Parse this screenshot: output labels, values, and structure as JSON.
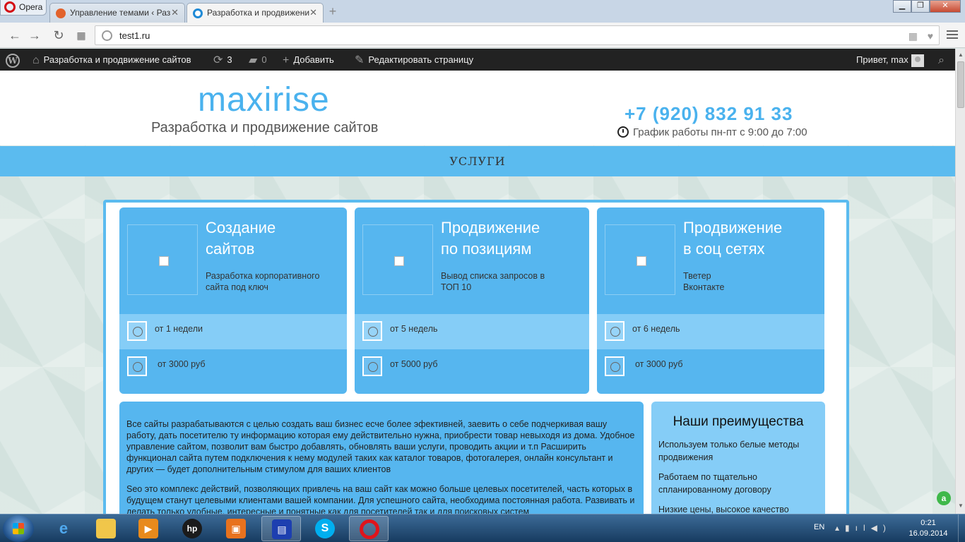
{
  "browser": {
    "menu_label": "Opera",
    "tabs": [
      {
        "title": "Управление темами ‹ Раз",
        "active": false
      },
      {
        "title": "Разработка и продвижени",
        "active": true
      }
    ],
    "url": "test1.ru"
  },
  "admin_bar": {
    "site_name": "Разработка и продвижение сайтов",
    "updates_count": "3",
    "comments_count": "0",
    "add_label": "Добавить",
    "edit_label": "Редактировать страницу",
    "greeting": "Привет, max"
  },
  "header": {
    "logo": "maxirise",
    "tagline": "Разработка и продвижение сайтов",
    "phone": "+7 (920) 832 91 33",
    "hours": "График работы пн-пт с 9:00 до 7:00"
  },
  "nav": {
    "label": "УСЛУГИ"
  },
  "services": [
    {
      "title_line1": "Создание",
      "title_line2": "сайтов",
      "desc_line1": "Разработка корпоративного",
      "desc_line2": "сайта под ключ",
      "term": "от 1 недели",
      "price": "от 3000 руб"
    },
    {
      "title_line1": "Продвижение",
      "title_line2": "по позициям",
      "desc_line1": "Вывод списка запросов в",
      "desc_line2": "ТОП 10",
      "term": "от 5 недель",
      "price": "от 5000 руб"
    },
    {
      "title_line1": "Продвижение",
      "title_line2": "в соц сетях",
      "desc_line1": "Тветер",
      "desc_line2": "Вконтакте",
      "term": "от 6 недель",
      "price": "от 3000 руб"
    }
  ],
  "about": {
    "p1": "Все сайты разрабатываются с целью создать ваш бизнес есче более эфективней, заевить о себе подчеркивая вашу работу, дать посетителю ту информацию которая ему действительно нужна, приобрести товар невыходя из дома. Удобное управление сайтом, позволит вам быстро добавлять, обновлять ваши услуги, проводить акции и т.п Расширить функционал сайта путем подключения к нему модулей таких как каталог товаров, фотогалерея, онлайн консультант и других — будет дополнительным стимулом для ваших клиентов",
    "p2": "Seo это комплекс действий, позволяющих привлечь на ваш сайт как можно больше целевых посетителей, часть которых в будущем станут целевыми клиентами вашей компании. Для успешного сайта, необходима постоянная работа. Развивать и делать только удобные, интересные и понятные как для посетителей так и для поисковых систем"
  },
  "advantages": {
    "title": "Наши преимущества",
    "items": [
      "Используем только белые методы продвижения",
      "Работаем по тщательно спланированному договору",
      "Низкие цены, высокое качество"
    ]
  },
  "taskbar": {
    "lang": "EN",
    "time": "0:21",
    "date": "16.09.2014"
  }
}
